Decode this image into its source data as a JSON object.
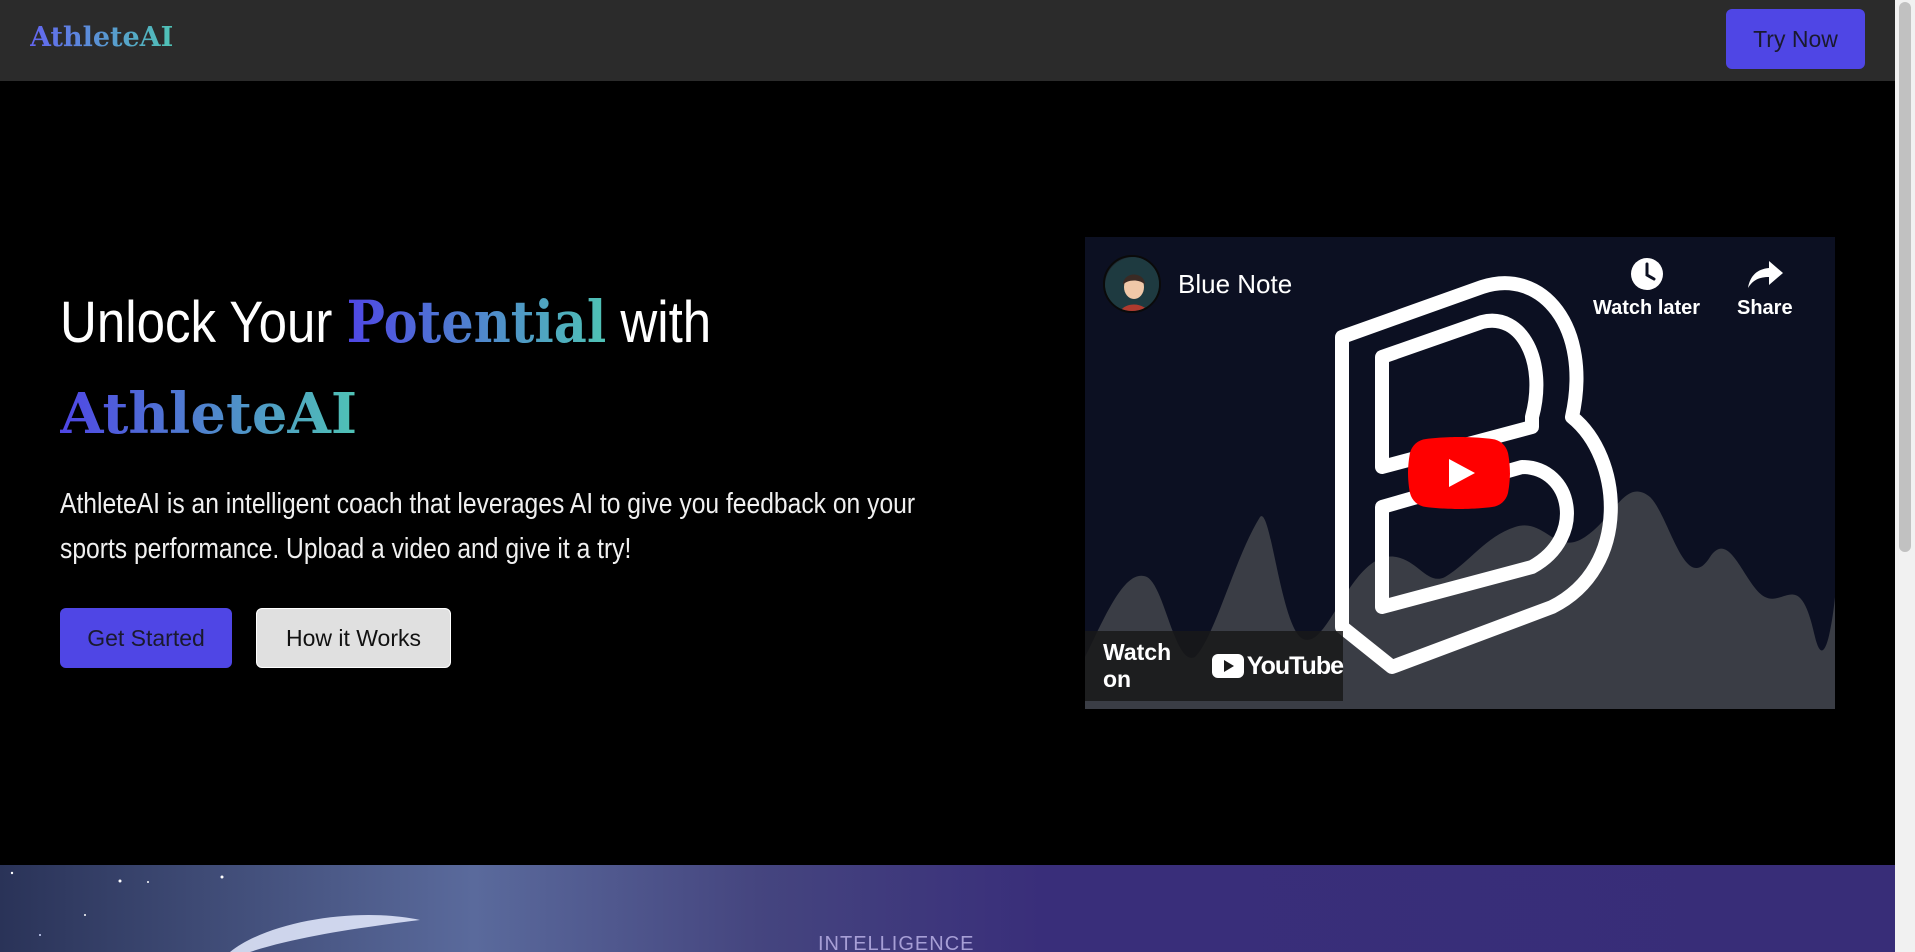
{
  "navbar": {
    "logo": "AthleteAI",
    "try_label": "Try Now"
  },
  "hero": {
    "title_pre": "Unlock Your ",
    "title_highlight": "Potential",
    "title_post": " with",
    "brand": "AthleteAI",
    "description": "AthleteAI is an intelligent coach that leverages AI to give you feedback on your sports performance. Upload a video and give it a try!",
    "get_started_label": "Get Started",
    "how_it_works_label": "How it Works"
  },
  "video": {
    "channel_name": "Blue Note",
    "watch_later_label": "Watch later",
    "share_label": "Share",
    "watch_on_label": "Watch on",
    "youtube_label": "YouTube"
  },
  "section": {
    "label": "INTELLIGENCE"
  },
  "colors": {
    "accent": "#4f46e5",
    "gradient_end": "#4fc3b5",
    "youtube_red": "#ff0000"
  }
}
